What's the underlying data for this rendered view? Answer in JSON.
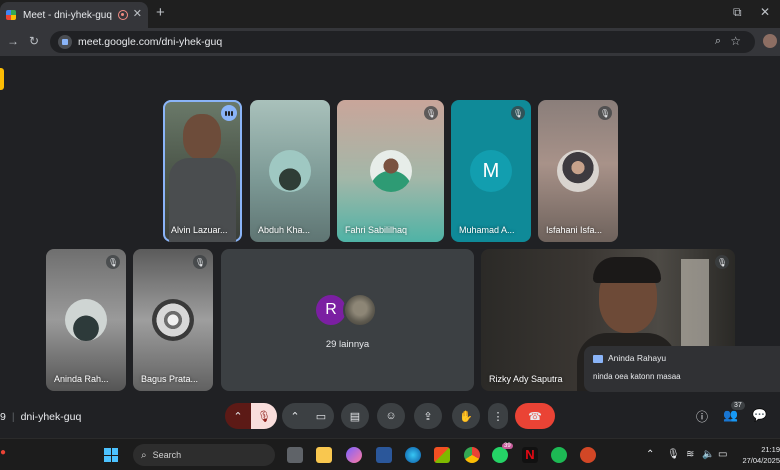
{
  "browser": {
    "tab_title": "Meet - dni-yhek-guq",
    "new_tab": "+",
    "url": "meet.google.com/dni-yhek-guq"
  },
  "participants": [
    {
      "name": "Alvin Lazuar...",
      "speaking": true
    },
    {
      "name": "Abduh Kha..."
    },
    {
      "name": "Fahri Sabililhaq",
      "muted": true
    },
    {
      "name": "Muhamad A...",
      "initial": "M",
      "muted": true
    },
    {
      "name": "Isfahani Isfa...",
      "muted": true
    },
    {
      "name": "Aninda Rah...",
      "muted": true
    },
    {
      "name": "Bagus Prata...",
      "muted": true
    },
    {
      "name": "Rizky Ady Saputra",
      "muted": true
    }
  ],
  "others": {
    "initial": "R",
    "count_label": "29 lainnya"
  },
  "chat_popup": {
    "sender": "Aninda Rahayu",
    "message": "ninda oea katonn masaa"
  },
  "meeting": {
    "code_prefix": "9",
    "code": "dni-yhek-guq",
    "people_count": "37"
  },
  "taskbar": {
    "search_placeholder": "Search",
    "whatsapp_badge": "39",
    "time": "21:19",
    "date": "27/04/2025"
  },
  "colors": {
    "accent": "#8ab4f8",
    "end_call": "#ea4335",
    "start_button": "#4cc2ff"
  }
}
